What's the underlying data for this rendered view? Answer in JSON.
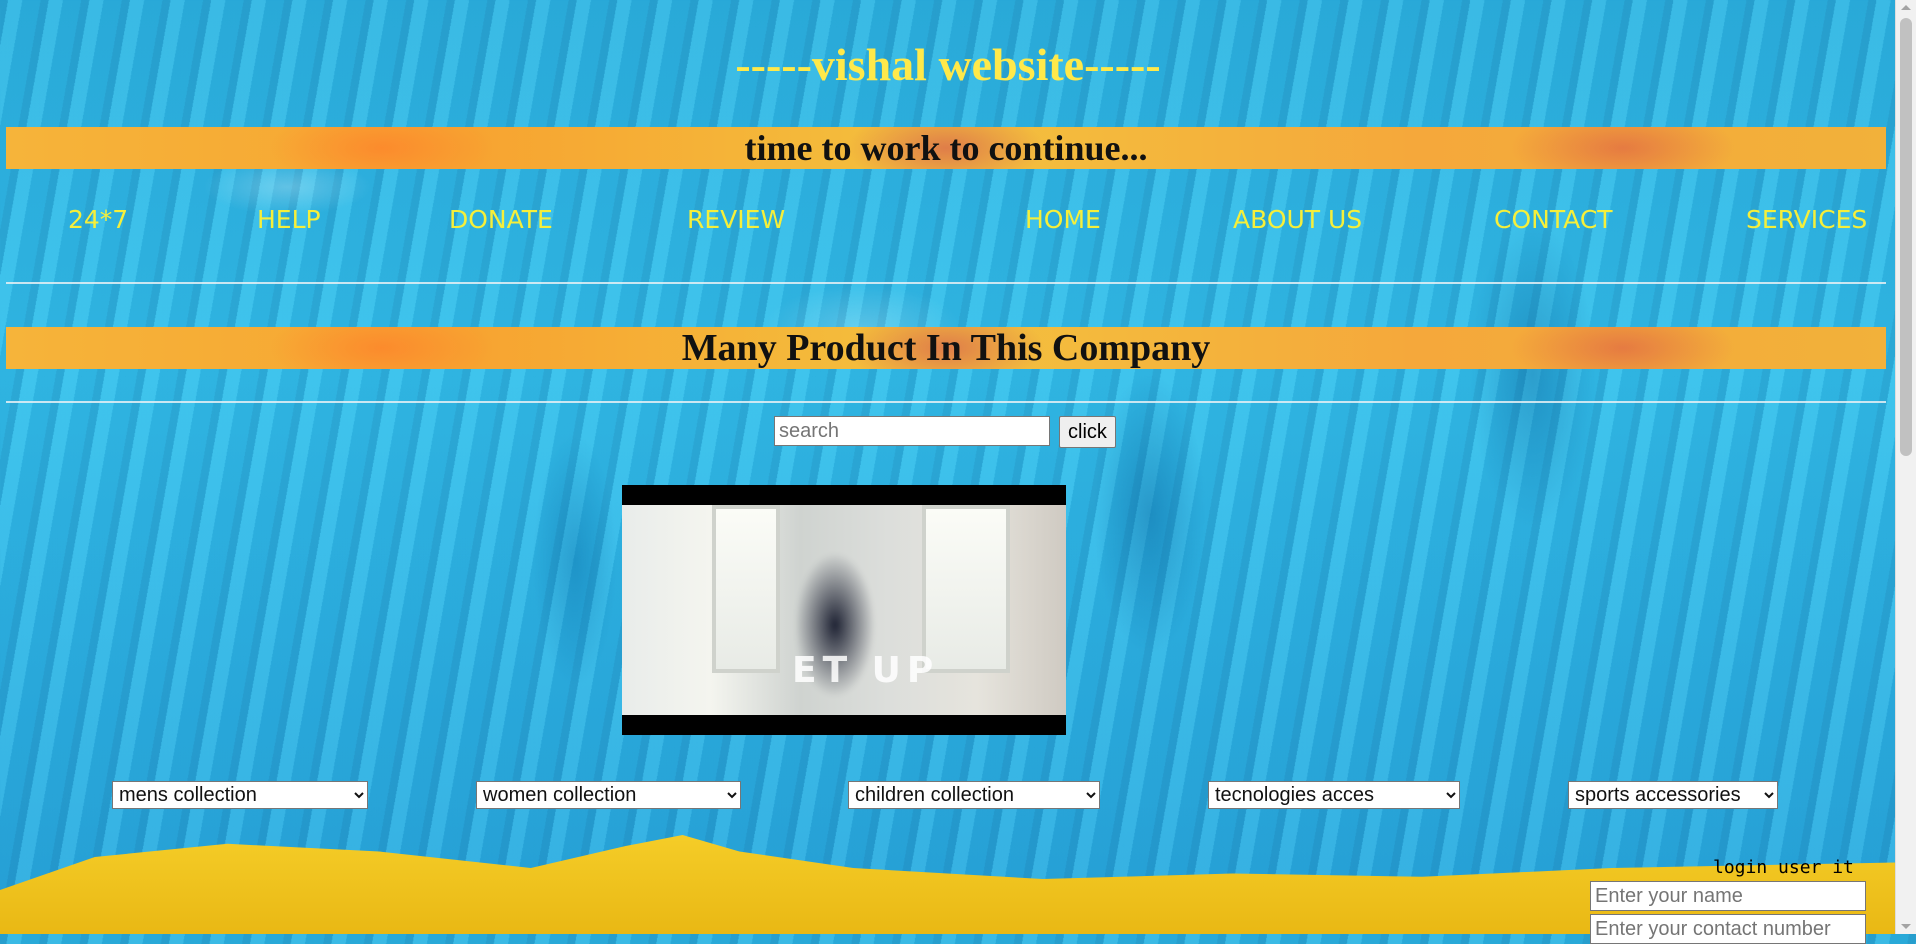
{
  "header": {
    "site_title": "-----vishal website-----",
    "tagline": "time to work to continue..."
  },
  "nav": {
    "items": [
      "24*7",
      "HELP",
      "DONATE",
      "REVIEW",
      "HOME",
      "ABOUT US",
      "CONTACT",
      "SERVICES"
    ]
  },
  "products": {
    "heading": "Many Product In This Company"
  },
  "search": {
    "placeholder": "search",
    "button_label": "click"
  },
  "video": {
    "overlay_text": "ET UP"
  },
  "collections": {
    "selected": [
      "mens collection",
      "women collection",
      "children collection",
      "tecnologies acces",
      "sports accessories"
    ]
  },
  "login": {
    "title": "login user it",
    "name_placeholder": "Enter your name",
    "contact_placeholder": "Enter your contact number"
  },
  "colors": {
    "title": "#ffe94a",
    "nav": "#f6ef3a",
    "background": "#2fb4e0",
    "banner": "#f6b43a"
  }
}
